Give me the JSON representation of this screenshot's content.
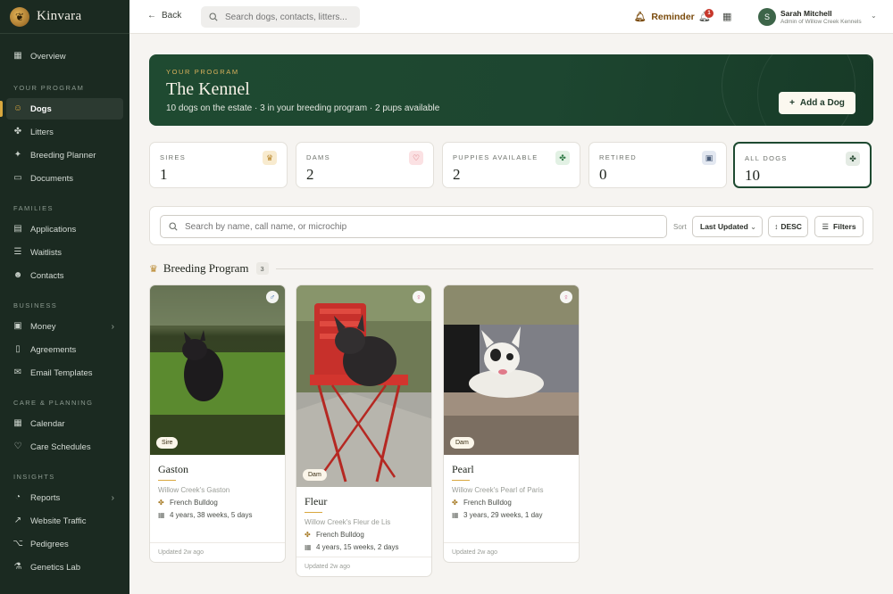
{
  "brand": {
    "name": "Kinvara"
  },
  "sidebar": {
    "overview": "Overview",
    "sections": {
      "program": "YOUR PROGRAM",
      "families": "FAMILIES",
      "business": "BUSINESS",
      "care": "CARE & PLANNING",
      "insights": "INSIGHTS"
    },
    "items": {
      "dogs": "Dogs",
      "litters": "Litters",
      "breeding_planner": "Breeding Planner",
      "documents": "Documents",
      "applications": "Applications",
      "waitlists": "Waitlists",
      "contacts": "Contacts",
      "money": "Money",
      "agreements": "Agreements",
      "email_templates": "Email Templates",
      "calendar": "Calendar",
      "care_schedules": "Care Schedules",
      "reports": "Reports",
      "website_traffic": "Website Traffic",
      "pedigrees": "Pedigrees",
      "genetics_lab": "Genetics Lab"
    }
  },
  "topbar": {
    "back_label": "Back",
    "search_placeholder": "Search dogs, contacts, litters...",
    "reminder_label": "Reminder",
    "notification_count": "1",
    "user_name": "Sarah Mitchell",
    "user_role": "Admin of Willow Creek Kennels",
    "user_initial": "S"
  },
  "hero": {
    "eyebrow": "YOUR PROGRAM",
    "title": "The Kennel",
    "subtitle": "10 dogs on the estate · 3 in your breeding program · 2 pups available",
    "add_button": "Add a Dog"
  },
  "stats": [
    {
      "label": "SIRES",
      "value": "1",
      "icon": "crown-icon"
    },
    {
      "label": "DAMS",
      "value": "2",
      "icon": "heart-icon"
    },
    {
      "label": "PUPPIES AVAILABLE",
      "value": "2",
      "icon": "paw-icon"
    },
    {
      "label": "RETIRED",
      "value": "0",
      "icon": "archive-icon"
    },
    {
      "label": "ALL DOGS",
      "value": "10",
      "icon": "paw-icon"
    }
  ],
  "filter": {
    "search_placeholder": "Search by name, call name, or microchip",
    "sort_label": "Sort",
    "sort_value": "Last Updated",
    "order_label": "DESC",
    "filters_label": "Filters"
  },
  "section": {
    "title": "Breeding Program",
    "count": "3"
  },
  "dogs": [
    {
      "name": "Gaston",
      "registered": "Willow Creek's Gaston",
      "breed": "French Bulldog",
      "age": "4 years, 38 weeks, 5 days",
      "role": "Sire",
      "sex": "male",
      "updated": "Updated 2w ago"
    },
    {
      "name": "Fleur",
      "registered": "Willow Creek's Fleur de Lis",
      "breed": "French Bulldog",
      "age": "4 years, 15 weeks, 2 days",
      "role": "Dam",
      "sex": "female",
      "updated": "Updated 2w ago"
    },
    {
      "name": "Pearl",
      "registered": "Willow Creek's Pearl of Paris",
      "breed": "French Bulldog",
      "age": "3 years, 29 weeks, 1 day",
      "role": "Dam",
      "sex": "female",
      "updated": "Updated 2w ago"
    }
  ],
  "colors": {
    "sidebar_bg": "#1b2a21",
    "hero_bg": "#1f4a31",
    "accent_gold": "#d9a83e",
    "male": "#4a79b5",
    "female": "#d45b8b"
  }
}
